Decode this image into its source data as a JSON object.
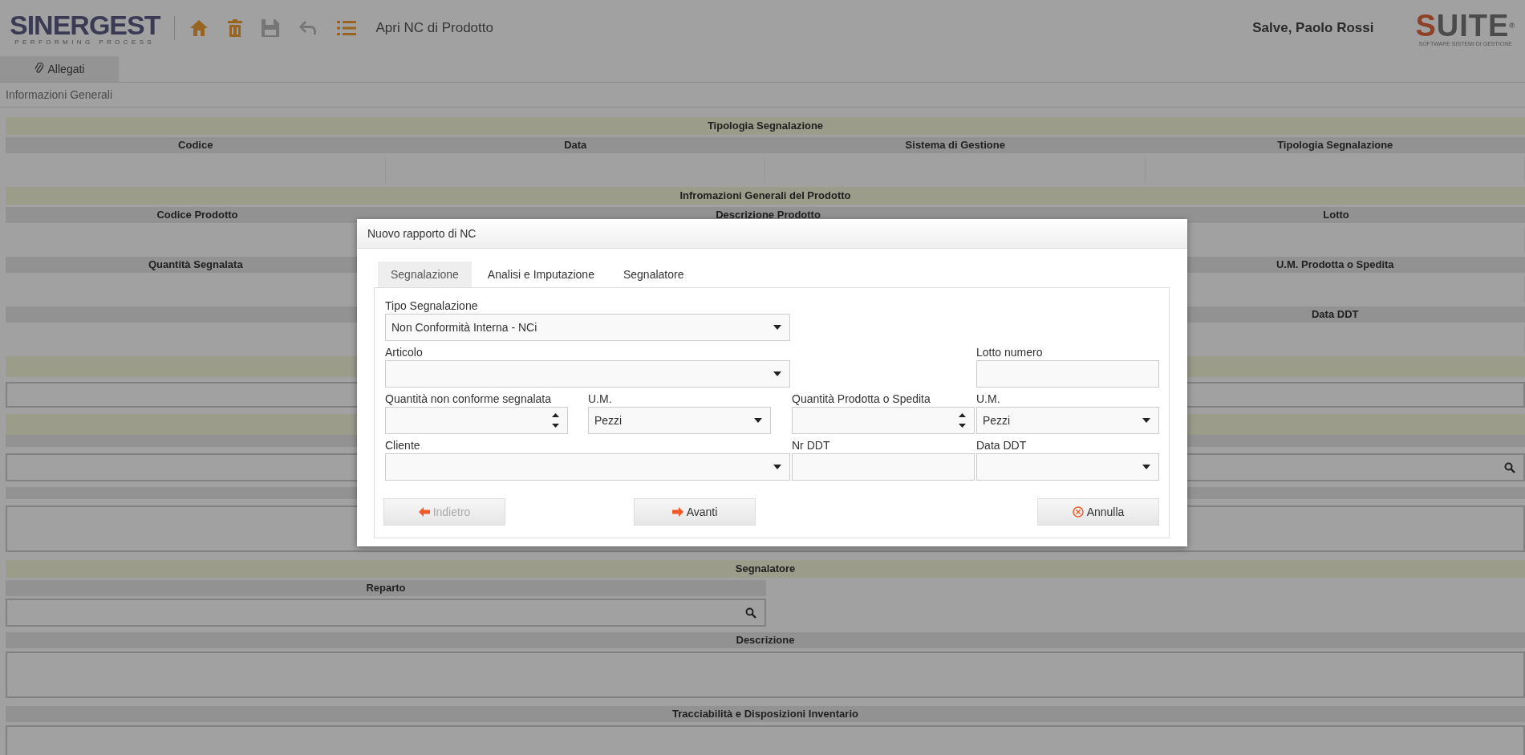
{
  "header": {
    "logo": {
      "name": "SINERGEST",
      "tagline": "PERFORMING PROCESS"
    },
    "toolbar": [
      {
        "kind": "home",
        "disabled": false
      },
      {
        "kind": "delete",
        "disabled": false
      },
      {
        "kind": "save",
        "disabled": true
      },
      {
        "kind": "undo",
        "disabled": true
      },
      {
        "kind": "list",
        "disabled": false
      }
    ],
    "title": "Apri NC di Prodotto",
    "greeting": "Salve, Paolo Rossi",
    "brand": {
      "name": "SUITE",
      "mark": "®",
      "tagline": "SOFTWARE SISTEMI DI GESTIONE"
    }
  },
  "attachments_button": "Allegati",
  "breadcrumb": "Informazioni Generali",
  "form": {
    "tipologia": {
      "title": "Tipologia Segnalazione",
      "columns": [
        "Codice",
        "Data",
        "Sistema di Gestione",
        "Tipologia Segnalazione"
      ]
    },
    "prodotto": {
      "title": "Infromazioni Generali del Prodotto",
      "columns": [
        "Codice Prodotto",
        "Descrizione Prodotto",
        "Lotto"
      ],
      "quantity_first": "Quantità Segnalata",
      "quantity_last": "U.M. Prodotta o Spedita",
      "ddt_last": "Data DDT"
    },
    "segnalatore": {
      "title": "Segnalatore",
      "reparto": "Reparto",
      "descrizione": "Descrizione",
      "tracciabilita": "Tracciabilità e Disposizioni Inventario"
    }
  },
  "dialog": {
    "title": "Nuovo rapporto di NC",
    "tabs": [
      {
        "label": "Segnalazione",
        "selected": true
      },
      {
        "label": "Analisi e Imputazione",
        "selected": false
      },
      {
        "label": "Segnalatore",
        "selected": false
      }
    ],
    "fields": [
      {
        "kind": "select",
        "label": "Tipo Segnalazione",
        "value": "Non Conformità Interna - NCi"
      },
      {
        "kind": "select",
        "label": "Articolo"
      },
      {
        "kind": "text",
        "label": "Lotto numero"
      },
      {
        "kind": "number",
        "label": "Quantità non conforme segnalata"
      },
      {
        "kind": "select",
        "label": "U.M.",
        "value": "Pezzi"
      },
      {
        "kind": "number",
        "label": "Quantità Prodotta o Spedita"
      },
      {
        "kind": "select",
        "label": "U.M.",
        "value": "Pezzi"
      },
      {
        "kind": "select",
        "label": "Cliente"
      },
      {
        "kind": "text",
        "label": "Nr DDT"
      },
      {
        "kind": "select",
        "label": "Data DDT"
      }
    ],
    "buttons": [
      {
        "kind": "back",
        "label": "Indietro",
        "disabled": true
      },
      {
        "kind": "next",
        "label": "Avanti",
        "disabled": false
      },
      {
        "kind": "cancel",
        "label": "Annulla",
        "disabled": false
      }
    ]
  }
}
